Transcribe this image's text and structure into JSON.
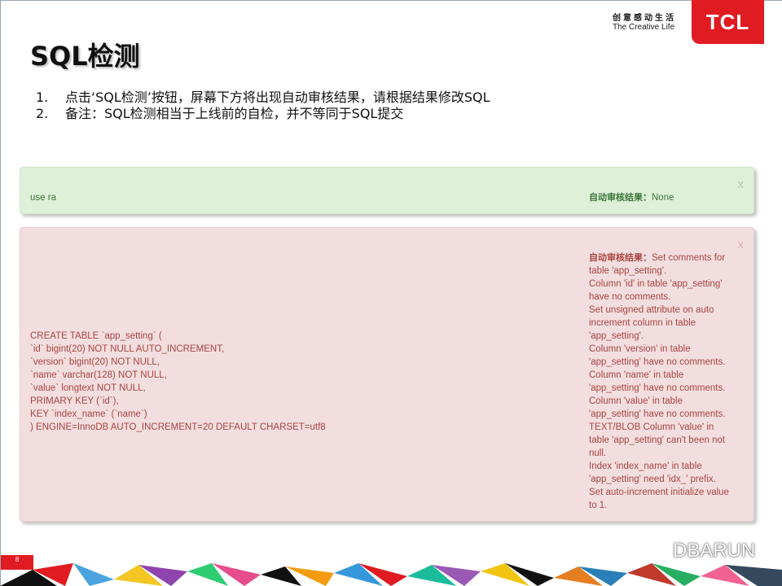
{
  "brand": {
    "slogan_cn": "创意感动生活",
    "slogan_en": "The Creative Life",
    "logo_text": "TCL",
    "accent_color": "#e01b22"
  },
  "title": "SQL检测",
  "steps": [
    {
      "num": "1.",
      "text": "点击‘SQL检测’按钮，屏幕下方将出现自动审核结果，请根据结果修改SQL"
    },
    {
      "num": "2.",
      "text": "备注：SQL检测相当于上线前的自检，并不等同于SQL提交"
    }
  ],
  "results": [
    {
      "status": "success",
      "close": "x",
      "sql": "use ra",
      "result_label": "自动审核结果：",
      "result_lines": [
        "None"
      ]
    },
    {
      "status": "error",
      "close": "x",
      "sql": "CREATE TABLE `app_setting` (\n`id` bigint(20) NOT NULL AUTO_INCREMENT,\n`version` bigint(20) NOT NULL,\n`name` varchar(128) NOT NULL,\n`value` longtext NOT NULL,\nPRIMARY KEY (`id`),\nKEY `index_name` (`name`)\n) ENGINE=InnoDB AUTO_INCREMENT=20 DEFAULT CHARSET=utf8",
      "result_label": "自动审核结果：",
      "result_lines": [
        "Set comments for",
        "table 'app_setting'.",
        "Column 'id' in table 'app_setting'",
        "have no comments.",
        "Set unsigned attribute on auto",
        "increment column in table",
        "'app_setting'.",
        "Column 'version' in table",
        "'app_setting' have no comments.",
        "Column 'name' in table",
        "'app_setting' have no comments.",
        "Column 'value' in table",
        "'app_setting' have no comments.",
        "TEXT/BLOB Column 'value' in",
        "table 'app_setting' can't been not",
        "null.",
        "Index 'index_name' in table",
        "'app_setting' need 'idx_' prefix.",
        "Set auto-increment initialize value",
        "to 1."
      ]
    }
  ],
  "footer": {
    "page_number": "8",
    "watermark": "DBARUN"
  }
}
